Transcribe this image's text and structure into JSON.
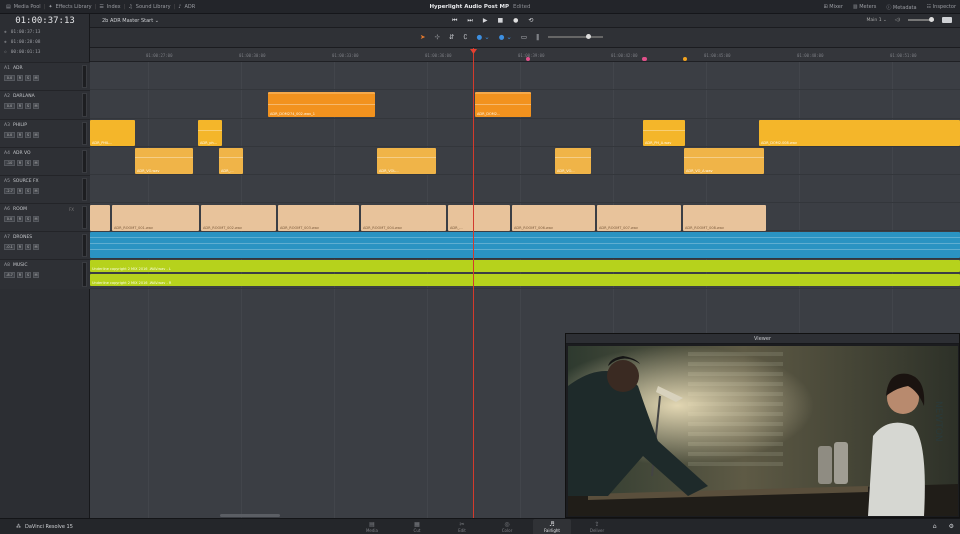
{
  "topbar": {
    "items": [
      "Media Pool",
      "Effects Library",
      "Index",
      "Sound Library",
      "ADR"
    ],
    "project_title": "Hyperlight Audio Post MP",
    "edited": "Edited",
    "right_items": [
      "Mixer",
      "Meters",
      "Metadata",
      "Inspector"
    ]
  },
  "left": {
    "timecode": "01:00:37:13",
    "rows": [
      {
        "sym": "◆",
        "value": "01:00:37:13"
      },
      {
        "sym": "◆",
        "value": "01:00:28:08"
      },
      {
        "sym": "◇",
        "value": "00:00:01:13"
      }
    ],
    "tracks": [
      {
        "id": "A1",
        "name": "ADR",
        "vol": "0.0"
      },
      {
        "id": "A2",
        "name": "DARLANA",
        "vol": "0.0"
      },
      {
        "id": "A3",
        "name": "PHILIP",
        "vol": "0.0"
      },
      {
        "id": "A4",
        "name": "ADR VO",
        "vol": "-10"
      },
      {
        "id": "A5",
        "name": "SOURCE FX",
        "vol": "-2.7"
      },
      {
        "id": "A6",
        "name": "ROOM",
        "vol": "0.0",
        "fx": "FX"
      },
      {
        "id": "A7",
        "name": "DRONES",
        "vol": "-0.1"
      },
      {
        "id": "A8",
        "name": "MUSIC",
        "vol": "-8.7"
      }
    ],
    "buttons": [
      "R",
      "S",
      "M"
    ]
  },
  "timeline": {
    "name": "2b ADR Master Start",
    "transport": [
      "⏮",
      "⏭",
      "▶",
      "■",
      "●",
      "⟲"
    ],
    "mix_label": "Main 1"
  },
  "ruler": {
    "ticks": [
      "01:00:27:00",
      "01:00:30:00",
      "01:00:33:00",
      "01:00:36:00",
      "01:00:39:00",
      "01:00:42:00",
      "01:00:45:00",
      "01:00:48:00",
      "01:00:51:00"
    ]
  },
  "clips": {
    "a2": [
      {
        "label": "ADR_DOM274_002.wav_1"
      },
      {
        "label": "ADR_DOM2..."
      }
    ],
    "a3": [
      {
        "label": "ADR_PHIL..."
      },
      {
        "label": "ADR_ph..."
      },
      {
        "label": "ADR_PH_A.wav"
      },
      {
        "label": "ADR_DOM2.008.wav"
      }
    ],
    "a4": [
      {
        "label": "ADR_VO.wav"
      },
      {
        "label": "ADR_..."
      },
      {
        "label": "ADR_VOL..."
      },
      {
        "label": "ADR_VO..."
      },
      {
        "label": "ADR_VO_A.wav"
      }
    ],
    "a6": [
      {
        "label": "ADR_ROOMT_001.wav"
      },
      {
        "label": "ADR_ROOMT_002.wav"
      },
      {
        "label": "ADR_ROOMT_003.wav"
      },
      {
        "label": "ADR_ROOMT_004.wav"
      },
      {
        "label": "ADR_..."
      },
      {
        "label": "ADR_ROOMT_006.wav"
      },
      {
        "label": "ADR_ROOMT_007.wav"
      },
      {
        "label": "ADR_ROOMT_008.wav"
      }
    ],
    "a8": [
      {
        "label": "Underline copyright 2 MIX 2016 .WAV.wav - L"
      },
      {
        "label": "Underline copyright 2 MIX 2016 .WAV.wav - R"
      }
    ]
  },
  "viewer": {
    "title": "Viewer",
    "sign": "NEWTON"
  },
  "bottom": {
    "brand": "DaVinci Resolve 15",
    "pages": [
      {
        "icon": "▤",
        "label": "Media"
      },
      {
        "icon": "▦",
        "label": "Cut"
      },
      {
        "icon": "✂",
        "label": "Edit"
      },
      {
        "icon": "◎",
        "label": "Color"
      },
      {
        "icon": "♬",
        "label": "Fairlight"
      },
      {
        "icon": "⇪",
        "label": "Deliver"
      }
    ],
    "right": [
      "⌂",
      "⚙"
    ]
  },
  "colors": {
    "playhead": "#d33a2c",
    "orange_clip": "#f2921e",
    "yellow_clip": "#f4b62a",
    "room_clip": "#e8c39b",
    "drone_clip": "#2a93c2",
    "music_clip": "#b6d21c"
  }
}
